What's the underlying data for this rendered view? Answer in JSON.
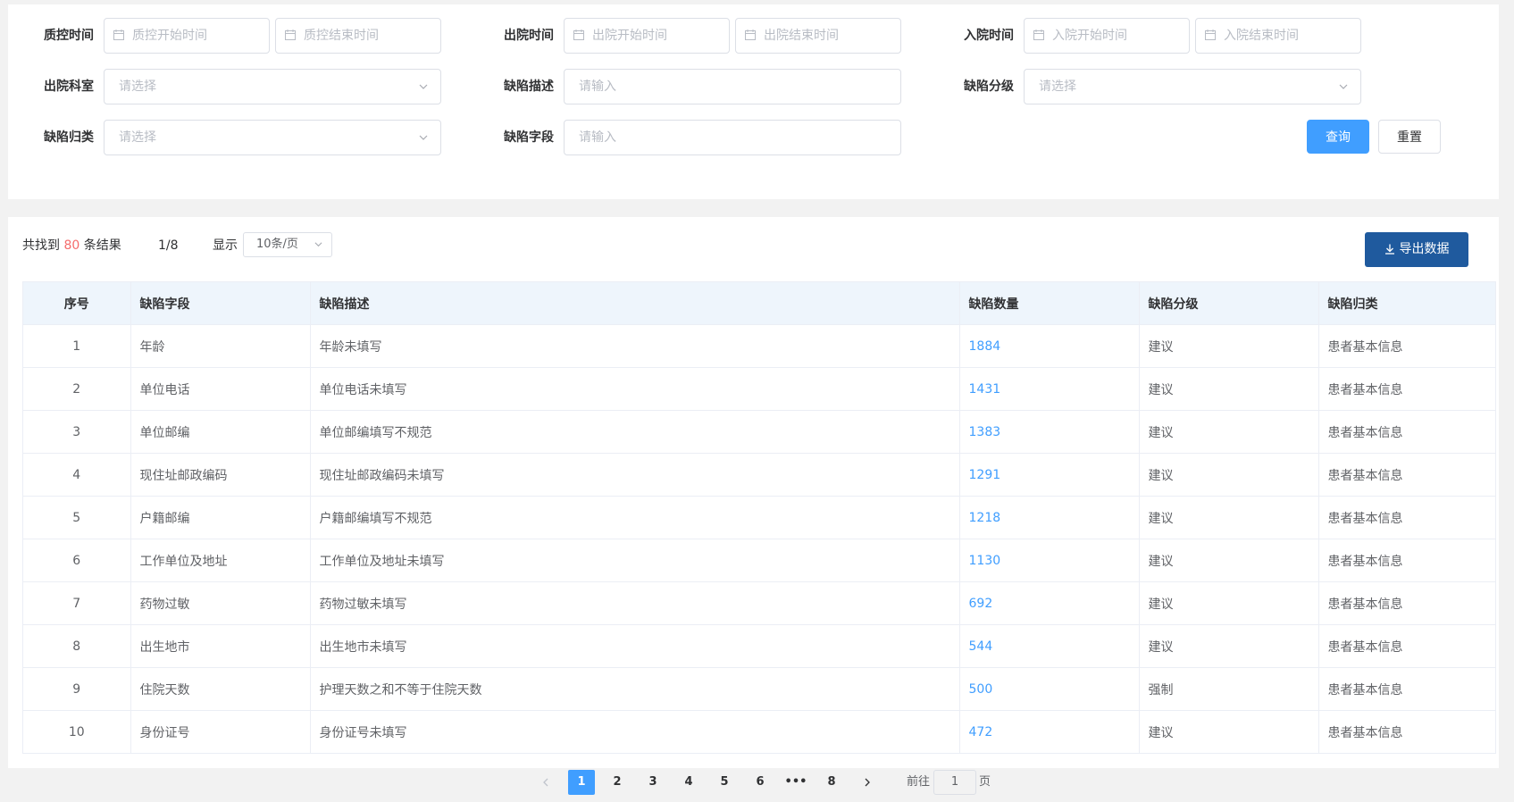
{
  "filters": {
    "qc_time": {
      "label": "质控时间",
      "start_placeholder": "质控开始时间",
      "end_placeholder": "质控结束时间"
    },
    "discharge_time": {
      "label": "出院时间",
      "start_placeholder": "出院开始时间",
      "end_placeholder": "出院结束时间"
    },
    "admission_time": {
      "label": "入院时间",
      "start_placeholder": "入院开始时间",
      "end_placeholder": "入院结束时间"
    },
    "discharge_dept": {
      "label": "出院科室",
      "placeholder": "请选择"
    },
    "defect_desc": {
      "label": "缺陷描述",
      "placeholder": "请输入"
    },
    "defect_level": {
      "label": "缺陷分级",
      "placeholder": "请选择"
    },
    "defect_category": {
      "label": "缺陷归类",
      "placeholder": "请选择"
    },
    "defect_field": {
      "label": "缺陷字段",
      "placeholder": "请输入"
    },
    "query_label": "查询",
    "reset_label": "重置"
  },
  "toolbar": {
    "found_prefix": "共找到",
    "found_count": "80",
    "found_suffix": "条结果",
    "page_indicator": "1/8",
    "show_label": "显示",
    "page_size": "10条/页",
    "export_label": "导出数据"
  },
  "table": {
    "headers": [
      "序号",
      "缺陷字段",
      "缺陷描述",
      "缺陷数量",
      "缺陷分级",
      "缺陷归类"
    ],
    "rows": [
      [
        "1",
        "年龄",
        "年龄未填写",
        "1884",
        "建议",
        "患者基本信息"
      ],
      [
        "2",
        "单位电话",
        "单位电话未填写",
        "1431",
        "建议",
        "患者基本信息"
      ],
      [
        "3",
        "单位邮编",
        "单位邮编填写不规范",
        "1383",
        "建议",
        "患者基本信息"
      ],
      [
        "4",
        "现住址邮政编码",
        "现住址邮政编码未填写",
        "1291",
        "建议",
        "患者基本信息"
      ],
      [
        "5",
        "户籍邮编",
        "户籍邮编填写不规范",
        "1218",
        "建议",
        "患者基本信息"
      ],
      [
        "6",
        "工作单位及地址",
        "工作单位及地址未填写",
        "1130",
        "建议",
        "患者基本信息"
      ],
      [
        "7",
        "药物过敏",
        "药物过敏未填写",
        "692",
        "建议",
        "患者基本信息"
      ],
      [
        "8",
        "出生地市",
        "出生地市未填写",
        "544",
        "建议",
        "患者基本信息"
      ],
      [
        "9",
        "住院天数",
        "护理天数之和不等于住院天数",
        "500",
        "强制",
        "患者基本信息"
      ],
      [
        "10",
        "身份证号",
        "身份证号未填写",
        "472",
        "建议",
        "患者基本信息"
      ]
    ]
  },
  "pagination": {
    "pages": [
      "1",
      "2",
      "3",
      "4",
      "5",
      "6",
      "•••",
      "8"
    ],
    "current": "1",
    "goto_prefix": "前往",
    "goto_value": "1",
    "goto_suffix": "页"
  },
  "colors": {
    "primary": "#409eff",
    "export": "#1f5a9e",
    "count_highlight": "#f56c6c"
  }
}
